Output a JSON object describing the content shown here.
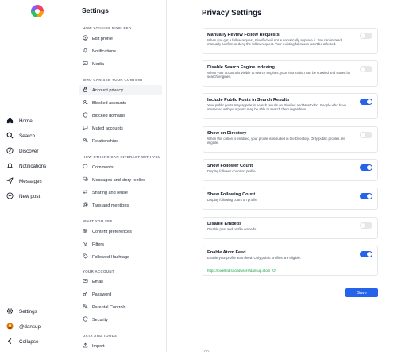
{
  "leftnav": {
    "items": [
      {
        "label": "Home",
        "icon": "home-icon"
      },
      {
        "label": "Search",
        "icon": "search-icon"
      },
      {
        "label": "Discover",
        "icon": "compass-icon"
      },
      {
        "label": "Notifications",
        "icon": "bell-icon"
      },
      {
        "label": "Messages",
        "icon": "send-icon"
      },
      {
        "label": "New post",
        "icon": "plus-circle-icon"
      }
    ],
    "settings_label": "Settings",
    "profile_label": "@dansup",
    "collapse_label": "Collapse"
  },
  "sidebar": {
    "title": "Settings",
    "groups": [
      {
        "label": "HOW YOU USE PIXELFED",
        "items": [
          "Edit profile",
          "Notifications",
          "Media"
        ]
      },
      {
        "label": "WHO CAN SEE YOUR CONTENT",
        "items": [
          "Account privacy",
          "Blocked accounts",
          "Blocked domains",
          "Muted accounts",
          "Relationships"
        ]
      },
      {
        "label": "HOW OTHERS CAN INTERACT WITH YOU",
        "items": [
          "Comments",
          "Messages and story replies",
          "Sharing and reuse",
          "Tags and mentions"
        ]
      },
      {
        "label": "WHAT YOU SEE",
        "items": [
          "Content preferences",
          "Filters",
          "Followed Hashtags"
        ]
      },
      {
        "label": "YOUR ACCOUNT",
        "items": [
          "Email",
          "Password",
          "Parental Controls",
          "Security"
        ]
      },
      {
        "label": "DATA AND TOOLS",
        "items": [
          "Import"
        ]
      }
    ],
    "active_item": "Account privacy"
  },
  "main": {
    "title": "Privacy Settings",
    "settings": [
      {
        "title": "Manually Review Follow Requests",
        "description": "When you get a follow request, Pixelfed will not automatically approve it. You can instead manually confirm or deny the follow request. Your existing followers won't be affected.",
        "enabled": false
      },
      {
        "title": "Disable Search Engine Indexing",
        "description": "When your account is visible to search engines, your information can be crawled and stored by search engines.",
        "enabled": false
      },
      {
        "title": "Include Public Posts in Search Results",
        "description": "Your public posts may appear in search results on Pixelfed and Mastodon. People who have interacted with your posts may be able to search them regardless.",
        "enabled": true
      },
      {
        "title": "Show on Directory",
        "description": "When this option is enabled, your profile is included in the Directory. Only public profiles are eligible.",
        "enabled": false
      },
      {
        "title": "Show Follower Count",
        "description": "Display follower count on profile",
        "enabled": true
      },
      {
        "title": "Show Following Count",
        "description": "Display following count on profile",
        "enabled": true
      },
      {
        "title": "Disable Embeds",
        "description": "Disable post and profile embeds",
        "enabled": false
      },
      {
        "title": "Enable Atom Feed",
        "description": "Enable your profile atom feed. Only public profiles are eligible.",
        "enabled": true,
        "link": "https://pixelfed.social/users/dansup.atom"
      }
    ],
    "save_label": "Save"
  },
  "colors": {
    "accent": "#2563eb",
    "link": "#16a34a",
    "toggle_off": "#e5e7eb"
  }
}
